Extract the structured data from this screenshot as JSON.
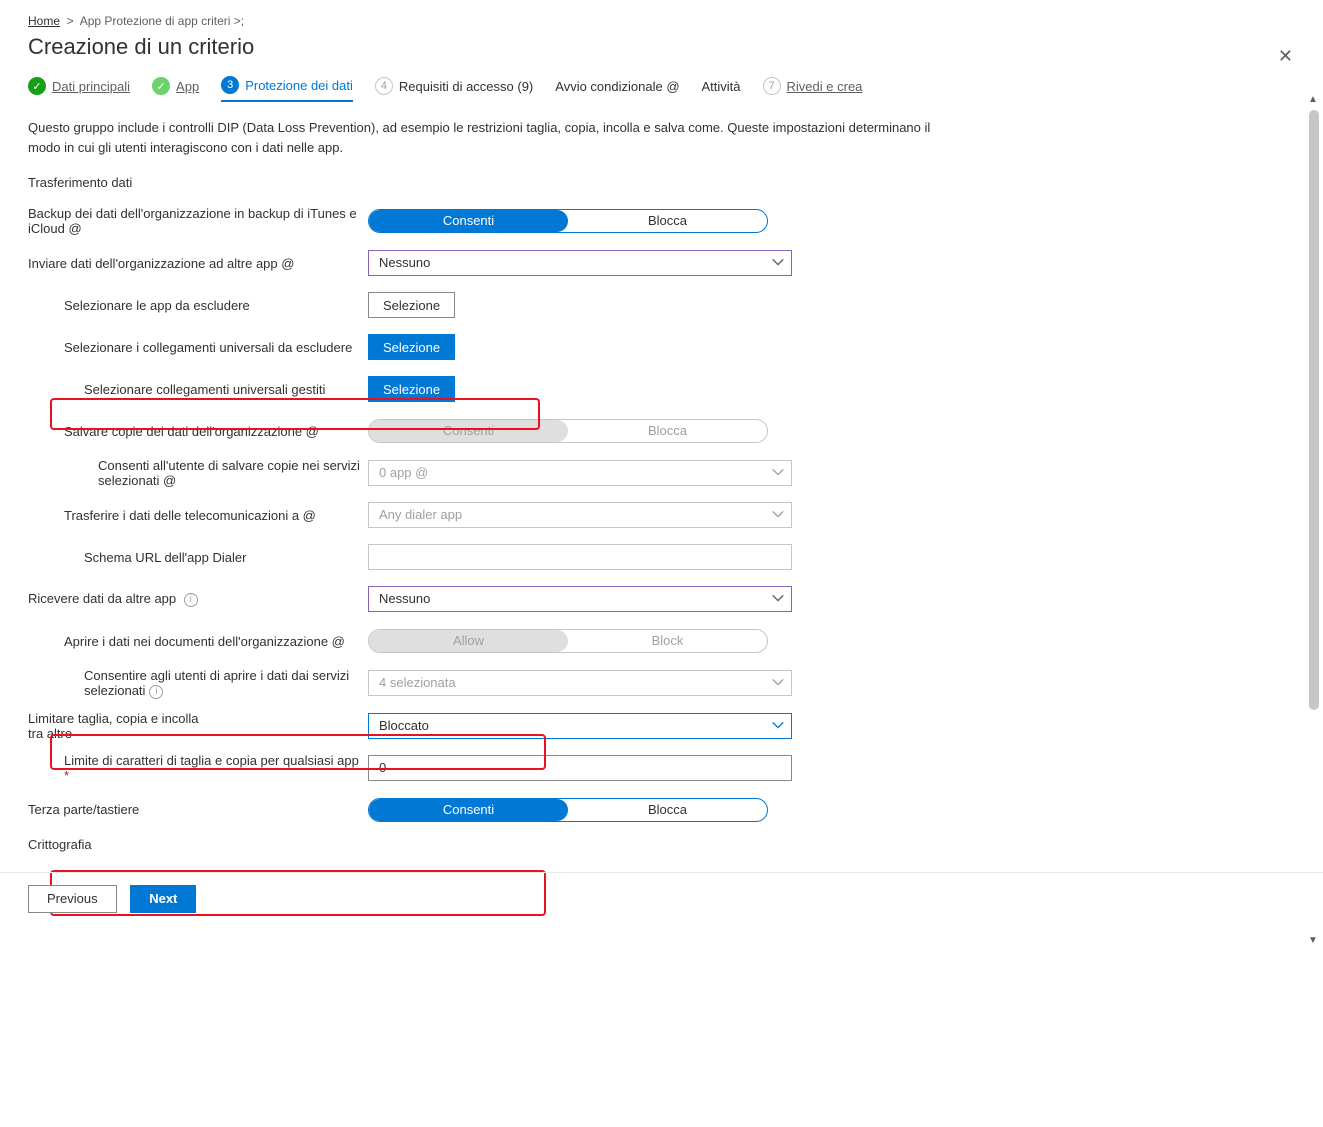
{
  "breadcrumb": {
    "home": "Home",
    "sep": ">",
    "second": "App Protezione di app criteri >;"
  },
  "title": "Creazione di un criterio",
  "close_label": "Close",
  "steps": [
    {
      "num": "✓",
      "label": "Dati principali"
    },
    {
      "num": "✓",
      "label": "App"
    },
    {
      "num": "3",
      "label": "Protezione dei dati"
    },
    {
      "num": "4",
      "label": "Requisiti di accesso (9)"
    },
    {
      "num": "",
      "label": "Avvio condizionale @"
    },
    {
      "num": "",
      "label": "Attività"
    },
    {
      "num": "7",
      "label": "Rivedi e crea"
    }
  ],
  "intro": "Questo gruppo include i controlli DIP (Data Loss Prevention), ad esempio le restrizioni taglia, copia, incolla e salva come. Queste impostazioni determinano il modo in cui gli utenti interagiscono con i dati nelle app.",
  "section_transfer": "Trasferimento dati",
  "rows": {
    "backup": {
      "label": "Backup dei dati dell'organizzazione in backup di iTunes e iCloud @",
      "opt_a": "Consenti",
      "opt_b": "Blocca"
    },
    "send": {
      "label": "Inviare dati dell'organizzazione ad altre app @",
      "value": "Nessuno"
    },
    "exclude_apps": {
      "label": "Selezionare le app da escludere",
      "btn": "Selezione"
    },
    "exclude_links": {
      "label": "Selezionare i collegamenti universali da escludere",
      "btn": "Selezione"
    },
    "managed_links": {
      "label": "Selezionare collegamenti universali gestiti",
      "btn": "Selezione"
    },
    "save_copies": {
      "label": "Salvare copie dei dati dell'organizzazione @",
      "opt_a": "Consenti",
      "opt_b": "Blocca"
    },
    "save_services": {
      "label": "Consenti all'utente di salvare copie nei servizi selezionati @",
      "value": "0 app @"
    },
    "telecom": {
      "label": "Trasferire i dati delle telecomunicazioni a @",
      "value": "Any dialer app"
    },
    "dialer": {
      "label": "Schema URL dell'app Dialer",
      "value": ""
    },
    "receive": {
      "label": "Ricevere dati da altre app",
      "value": "Nessuno"
    },
    "open_docs": {
      "label": "Aprire i dati nei documenti dell'organizzazione @",
      "opt_a": "Allow",
      "opt_b": "Block"
    },
    "open_services": {
      "label": "Consentire agli utenti di aprire i dati dai servizi selezionati",
      "value": "4 selezionata"
    },
    "restrict_cut": {
      "label_l1": "Limitare taglia, copia e incolla",
      "label_l2": "tra altre",
      "value": "Bloccato"
    },
    "char_limit": {
      "label": "Limite di caratteri di taglia e copia per qualsiasi app",
      "star": "*",
      "value": "0"
    },
    "keyboards": {
      "label": "Terza parte/tastiere",
      "opt_a": "Consenti",
      "opt_b": "Blocca"
    }
  },
  "section_crypto": "Crittografia",
  "footer": {
    "prev": "Previous",
    "next": "Next"
  }
}
